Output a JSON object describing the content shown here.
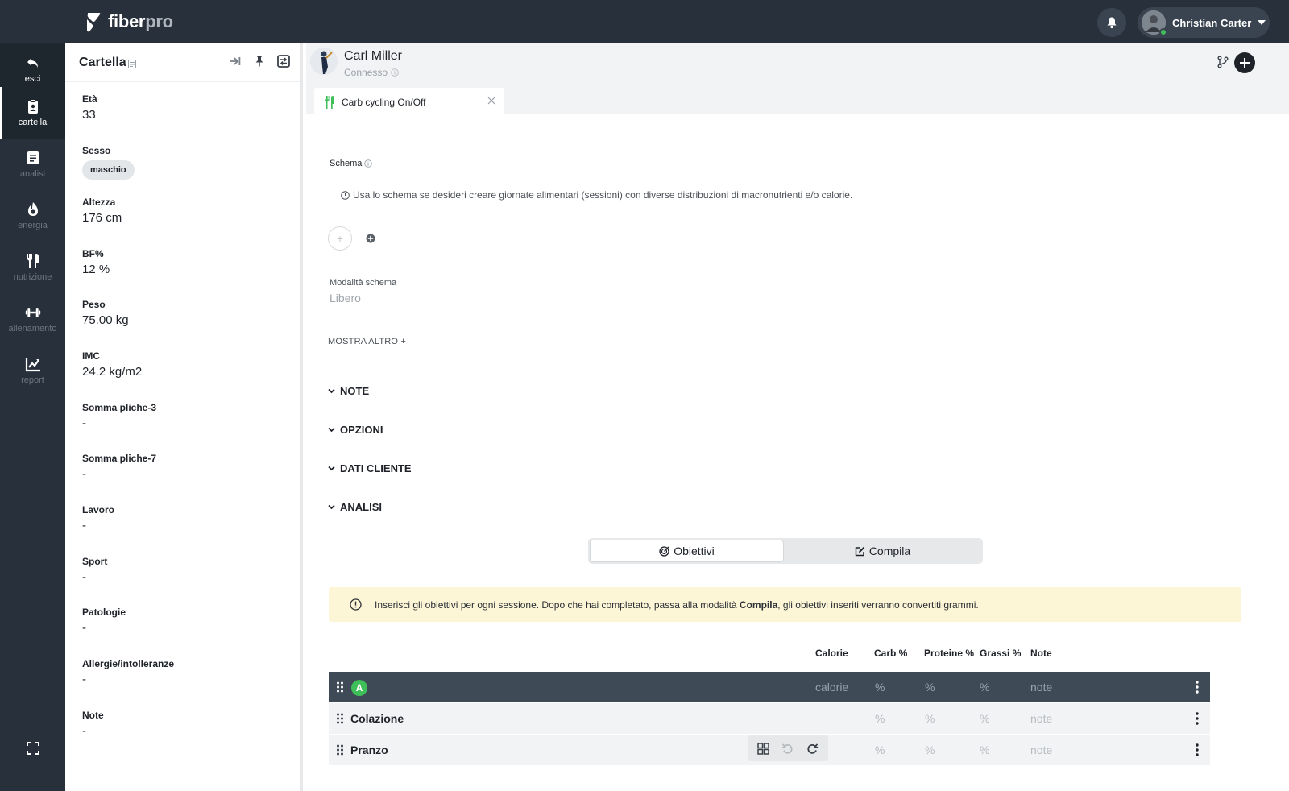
{
  "app": {
    "brand_bold": "fiber",
    "brand_light": "pro"
  },
  "topbar": {
    "user_name": "Christian Carter"
  },
  "nav": {
    "exit": "esci",
    "items": [
      {
        "label": "cartella",
        "icon": "clipboard-user-icon",
        "active": true
      },
      {
        "label": "analisi",
        "icon": "document-icon"
      },
      {
        "label": "energia",
        "icon": "flame-icon"
      },
      {
        "label": "nutrizione",
        "icon": "utensils-icon"
      },
      {
        "label": "allenamento",
        "icon": "dumbbell-icon"
      },
      {
        "label": "report",
        "icon": "chart-line-icon"
      }
    ]
  },
  "record": {
    "title": "Cartella",
    "fields": [
      {
        "label": "Età",
        "value": "33"
      },
      {
        "label": "Sesso",
        "value": "maschio",
        "chip": true
      },
      {
        "label": "Altezza",
        "value": "176 cm"
      },
      {
        "label": "BF%",
        "value": "12 %"
      },
      {
        "label": "Peso",
        "value": "75.00 kg"
      },
      {
        "label": "IMC",
        "value": "24.2 kg/m2"
      },
      {
        "label": "Somma pliche-3",
        "value": "-"
      },
      {
        "label": "Somma pliche-7",
        "value": "-"
      },
      {
        "label": "Lavoro",
        "value": "-"
      },
      {
        "label": "Sport",
        "value": "-"
      },
      {
        "label": "Patologie",
        "value": "-"
      },
      {
        "label": "Allergie/intolleranze",
        "value": "-"
      },
      {
        "label": "Note",
        "value": "-"
      }
    ]
  },
  "client": {
    "name": "Carl Miller",
    "status": "Connesso"
  },
  "tab": {
    "label": "Carb cycling On/Off"
  },
  "schema": {
    "label": "Schema",
    "hint": "Usa lo schema se desideri creare giornate alimentari (sessioni) con diverse distribuzioni di macronutrienti e/o calorie.",
    "plus": "+",
    "mode_label": "Modalità schema",
    "mode_value": "Libero",
    "show_more": "MOSTRA ALTRO +"
  },
  "sections": [
    "NOTE",
    "OPZIONI",
    "DATI CLIENTE",
    "ANALISI"
  ],
  "toggle": {
    "goals": "Obiettivi",
    "fill": "Compila"
  },
  "alert": {
    "before": "Inserisci gli obiettivi per ogni sessione. Dopo che hai completato, passa alla modalità ",
    "bold": "Compila",
    "after": ", gli obiettivi inseriti verranno convertiti grammi."
  },
  "table": {
    "columns": [
      "Calorie",
      "Carb %",
      "Proteine %",
      "Grassi %",
      "Note"
    ],
    "session_badge": "A",
    "session_row": {
      "calories": "calorie",
      "carb": "%",
      "protein": "%",
      "fat": "%",
      "note": "note"
    },
    "meals": [
      {
        "name": "Colazione",
        "carb": "%",
        "protein": "%",
        "fat": "%",
        "note": "note"
      },
      {
        "name": "Pranzo",
        "carb": "%",
        "protein": "%",
        "fat": "%",
        "note": "note"
      }
    ]
  },
  "colors": {
    "sidebar": "#28313b",
    "accent_green": "#3fbf5a",
    "alert_bg": "#fcf5d6",
    "session_row": "#3e4a56"
  }
}
